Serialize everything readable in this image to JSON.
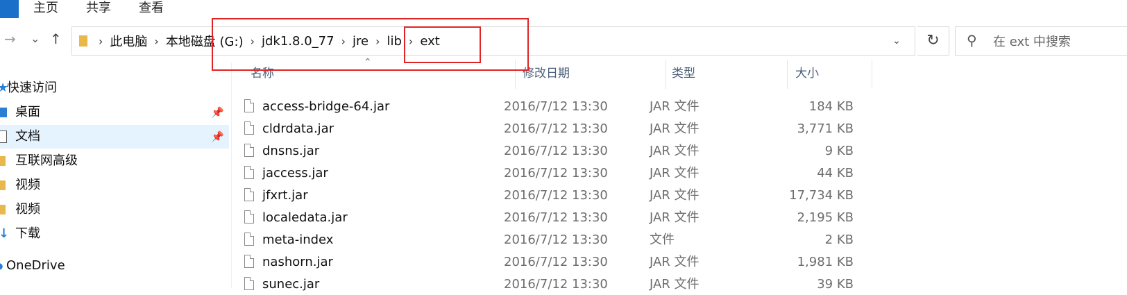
{
  "ribbon": {
    "tabs": [
      "主页",
      "共享",
      "查看"
    ]
  },
  "nav": {
    "back_icon": "←",
    "forward_icon": "→",
    "recent_icon": "⌄",
    "up_icon": "↑",
    "breadcrumbs": [
      "此电脑",
      "本地磁盘 (G:)",
      "jdk1.8.0_77",
      "jre",
      "lib",
      "ext"
    ],
    "search_placeholder": "在 ext 中搜索"
  },
  "sidebar": {
    "items": [
      {
        "label": "快速访问",
        "icon": "star-icon"
      },
      {
        "label": "桌面",
        "icon": "desktop-icon",
        "pinned": true
      },
      {
        "label": "文档",
        "icon": "document-icon",
        "pinned": true,
        "selected": true
      },
      {
        "label": "互联网高级",
        "icon": "folder-icon"
      },
      {
        "label": "视频",
        "icon": "folder-icon"
      },
      {
        "label": "视频",
        "icon": "folder-icon"
      },
      {
        "label": "下载",
        "icon": "download-icon"
      },
      {
        "label": "OneDrive",
        "icon": "cloud-icon"
      }
    ]
  },
  "columns": {
    "name": "名称",
    "date": "修改日期",
    "type": "类型",
    "size": "大小"
  },
  "files": [
    {
      "name": "access-bridge-64.jar",
      "date": "2016/7/12 13:30",
      "type": "JAR 文件",
      "size": "184 KB"
    },
    {
      "name": "cldrdata.jar",
      "date": "2016/7/12 13:30",
      "type": "JAR 文件",
      "size": "3,771 KB"
    },
    {
      "name": "dnsns.jar",
      "date": "2016/7/12 13:30",
      "type": "JAR 文件",
      "size": "9 KB"
    },
    {
      "name": "jaccess.jar",
      "date": "2016/7/12 13:30",
      "type": "JAR 文件",
      "size": "44 KB"
    },
    {
      "name": "jfxrt.jar",
      "date": "2016/7/12 13:30",
      "type": "JAR 文件",
      "size": "17,734 KB"
    },
    {
      "name": "localedata.jar",
      "date": "2016/7/12 13:30",
      "type": "JAR 文件",
      "size": "2,195 KB"
    },
    {
      "name": "meta-index",
      "date": "2016/7/12 13:30",
      "type": "文件",
      "size": "2 KB"
    },
    {
      "name": "nashorn.jar",
      "date": "2016/7/12 13:30",
      "type": "JAR 文件",
      "size": "1,981 KB"
    },
    {
      "name": "sunec.jar",
      "date": "2016/7/12 13:30",
      "type": "JAR 文件",
      "size": "39 KB"
    }
  ],
  "colors": {
    "accent": "#1a6fc9",
    "annotation": "#e02424",
    "selection": "#e5f3ff",
    "folder": "#e8b84a"
  }
}
